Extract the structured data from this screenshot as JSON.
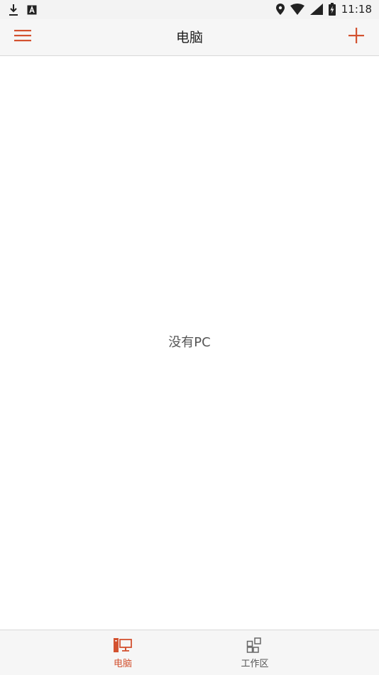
{
  "status_bar": {
    "time": "11:18",
    "icons": [
      "download-icon",
      "a-icon",
      "location-icon",
      "wifi-icon",
      "signal-icon",
      "battery-charging-icon"
    ]
  },
  "app_bar": {
    "title": "电脑",
    "menu_icon": "menu-icon",
    "add_icon": "plus-icon"
  },
  "main": {
    "empty_message": "没有PC"
  },
  "bottom_nav": {
    "items": [
      {
        "label": "电脑",
        "icon": "desktop-icon",
        "selected": true
      },
      {
        "label": "工作区",
        "icon": "workspace-grid-icon",
        "selected": false
      }
    ]
  },
  "colors": {
    "accent": "#d35230",
    "text_primary": "#1f1f1f",
    "text_secondary": "#555555",
    "bar_background": "#f6f6f6"
  }
}
